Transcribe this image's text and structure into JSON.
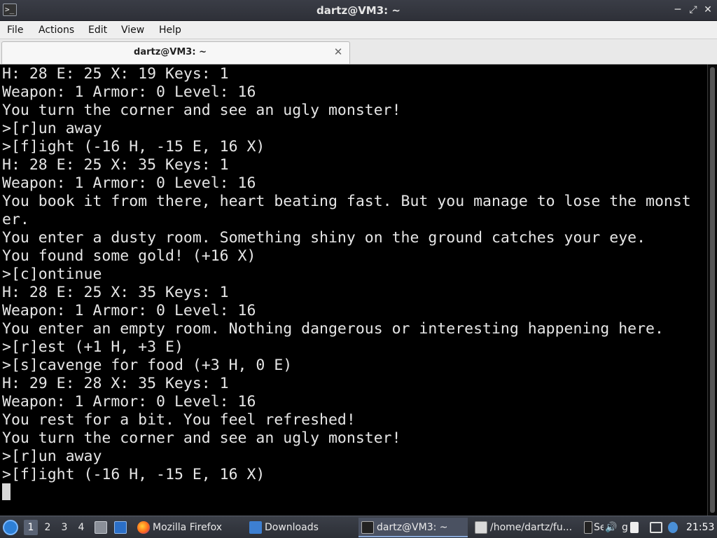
{
  "window": {
    "title": "dartz@VM3: ~",
    "controls": [
      "minimize-icon",
      "maximize-icon",
      "close-icon"
    ]
  },
  "menu": {
    "items": [
      "File",
      "Actions",
      "Edit",
      "View",
      "Help"
    ]
  },
  "tabs": [
    {
      "label": "dartz@VM3: ~",
      "close": "✕"
    }
  ],
  "terminal": {
    "lines": [
      "H: 28 E: 25 X: 19 Keys: 1",
      "Weapon: 1 Armor: 0 Level: 16",
      "You turn the corner and see an ugly monster!",
      ">[r]un away",
      ">[f]ight (-16 H, -15 E, 16 X)",
      "H: 28 E: 25 X: 35 Keys: 1",
      "Weapon: 1 Armor: 0 Level: 16",
      "You book it from there, heart beating fast. But you manage to lose the monst",
      "er.",
      "You enter a dusty room. Something shiny on the ground catches your eye.",
      "You found some gold! (+16 X)",
      ">[c]ontinue",
      "H: 28 E: 25 X: 35 Keys: 1",
      "Weapon: 1 Armor: 0 Level: 16",
      "You enter an empty room. Nothing dangerous or interesting happening here.",
      ">[r]est (+1 H, +3 E)",
      ">[s]cavenge for food (+3 H, 0 E)",
      "H: 29 E: 28 X: 35 Keys: 1",
      "Weapon: 1 Armor: 0 Level: 16",
      "You rest for a bit. You feel refreshed!",
      "You turn the corner and see an ugly monster!",
      ">[r]un away",
      ">[f]ight (-16 H, -15 E, 16 X)"
    ]
  },
  "taskbar": {
    "desktops": [
      "1",
      "2",
      "3",
      "4"
    ],
    "active_desktop": "1",
    "tasks": [
      {
        "label": "Mozilla Firefox",
        "icon": "firefox-icon"
      },
      {
        "label": "Downloads",
        "icon": "folder-icon"
      },
      {
        "label": "dartz@VM3: ~",
        "icon": "terminal-icon"
      },
      {
        "label": "/home/dartz/fu...",
        "icon": "text-editor-icon"
      },
      {
        "label": "Se",
        "icon": "terminal-icon"
      },
      {
        "label": "g",
        "icon": "generic-app-icon"
      }
    ],
    "clock": "21:53"
  },
  "colors": {
    "terminal_bg": "#000000",
    "terminal_fg": "#e6e6e6",
    "titlebar_bg": "#33363e",
    "taskbar_bg": "#33363d"
  }
}
